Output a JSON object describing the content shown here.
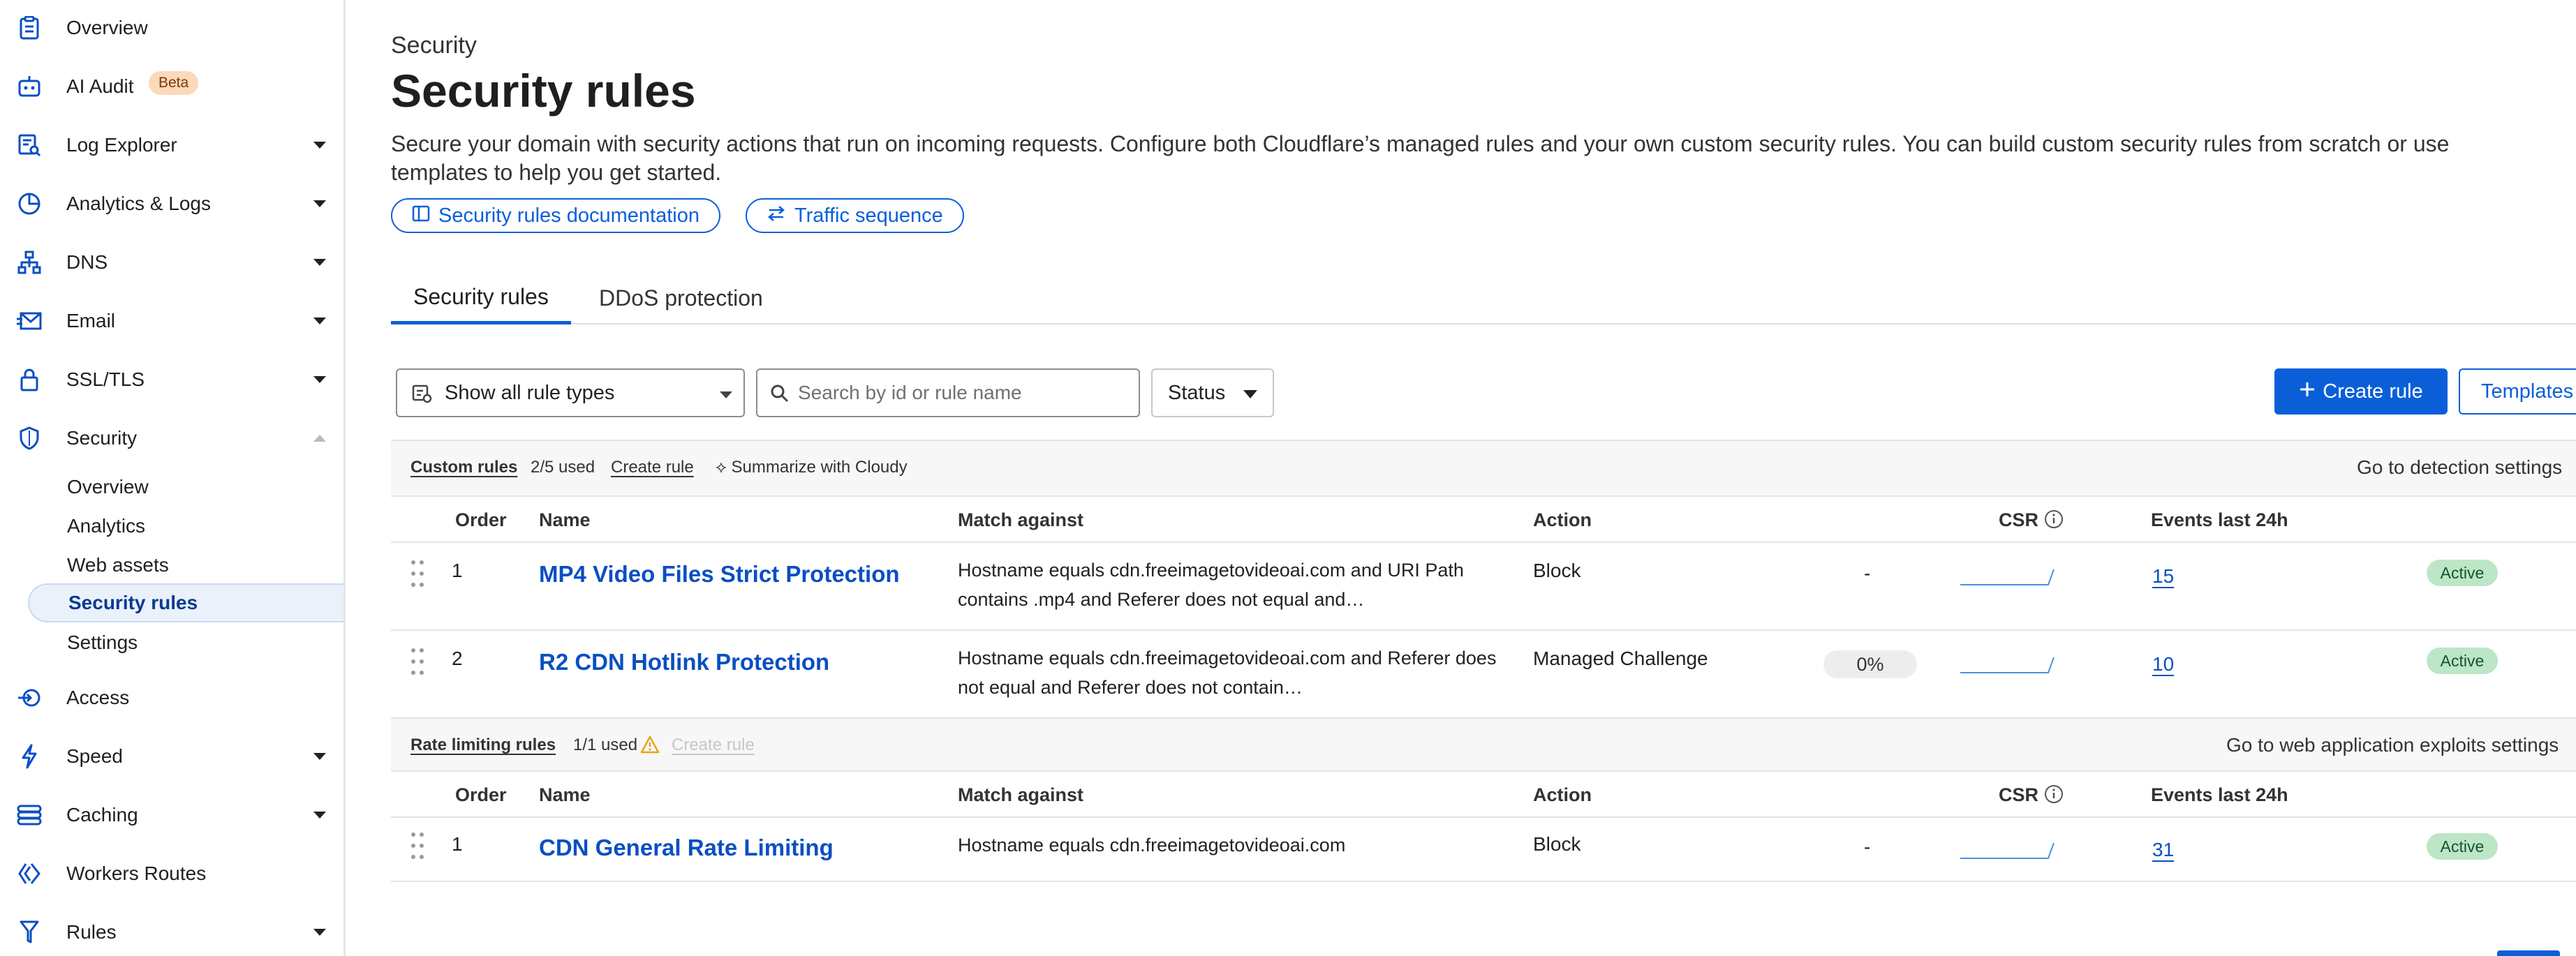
{
  "sidebar": {
    "items": [
      {
        "label": "Overview",
        "icon": "clipboard-icon"
      },
      {
        "label": "AI Audit",
        "icon": "robot-icon",
        "badge": "Beta"
      },
      {
        "label": "Log Explorer",
        "icon": "log-explorer-icon"
      },
      {
        "label": "Analytics & Logs",
        "icon": "pie-chart-icon"
      },
      {
        "label": "DNS",
        "icon": "dns-network-icon"
      },
      {
        "label": "Email",
        "icon": "email-icon"
      },
      {
        "label": "SSL/TLS",
        "icon": "lock-icon"
      },
      {
        "label": "Security",
        "icon": "shield-icon"
      },
      {
        "label": "Access",
        "icon": "access-icon"
      },
      {
        "label": "Speed",
        "icon": "lightning-icon"
      },
      {
        "label": "Caching",
        "icon": "caching-icon"
      },
      {
        "label": "Workers Routes",
        "icon": "workers-icon"
      },
      {
        "label": "Rules",
        "icon": "rules-icon"
      }
    ],
    "security_sub": [
      "Overview",
      "Analytics",
      "Web assets",
      "Security rules",
      "Settings"
    ]
  },
  "header": {
    "kicker": "Security",
    "title": "Security rules",
    "description": "Secure your domain with security actions that run on incoming requests. Configure both Cloudflare’s managed rules and your own custom security rules. You can build custom security rules from scratch or use templates to help you get started.",
    "docs_link": "Security rules documentation",
    "traffic_link": "Traffic sequence"
  },
  "tabs": [
    "Security rules",
    "DDoS protection"
  ],
  "filters": {
    "rule_type": "Show all rule types",
    "search_placeholder": "Search by id or rule name",
    "status": "Status",
    "create_rule": "Create rule",
    "templates": "Templates"
  },
  "custom_rules": {
    "title": "Custom rules",
    "usage": "2/5 used",
    "create_rule": "Create rule",
    "summarize": "Summarize with Cloudy",
    "settings_link": "Go to detection settings",
    "columns": {
      "order": "Order",
      "name": "Name",
      "match": "Match against",
      "action": "Action",
      "csr": "CSR",
      "events": "Events last 24h"
    },
    "rows": [
      {
        "order": "1",
        "name": "MP4 Video Files Strict Protection",
        "match": "Hostname equals cdn.freeimagetovideoai.com and URI Path contains .mp4 and Referer does not equal and…",
        "action": "Block",
        "csr": "-",
        "events": "15",
        "status": "Active"
      },
      {
        "order": "2",
        "name": "R2 CDN Hotlink Protection",
        "match": "Hostname equals cdn.freeimagetovideoai.com and Referer does not equal and Referer does not contain…",
        "action": "Managed Challenge",
        "csr": "0%",
        "events": "10",
        "status": "Active"
      }
    ]
  },
  "rate_rules": {
    "title": "Rate limiting rules",
    "usage": "1/1 used",
    "create_rule": "Create rule",
    "settings_link": "Go to web application exploits settings",
    "columns": {
      "order": "Order",
      "name": "Name",
      "match": "Match against",
      "action": "Action",
      "csr": "CSR",
      "events": "Events last 24h"
    },
    "rows": [
      {
        "order": "1",
        "name": "CDN General Rate Limiting",
        "match": "Hostname equals cdn.freeimagetovideoai.com",
        "action": "Block",
        "csr": "-",
        "events": "31",
        "status": "Active"
      }
    ]
  },
  "colors": {
    "accent": "#0a5fd9",
    "active_badge": "#bde6c6",
    "beta_badge": "#fbd9b9",
    "warning": "#e8a317"
  }
}
